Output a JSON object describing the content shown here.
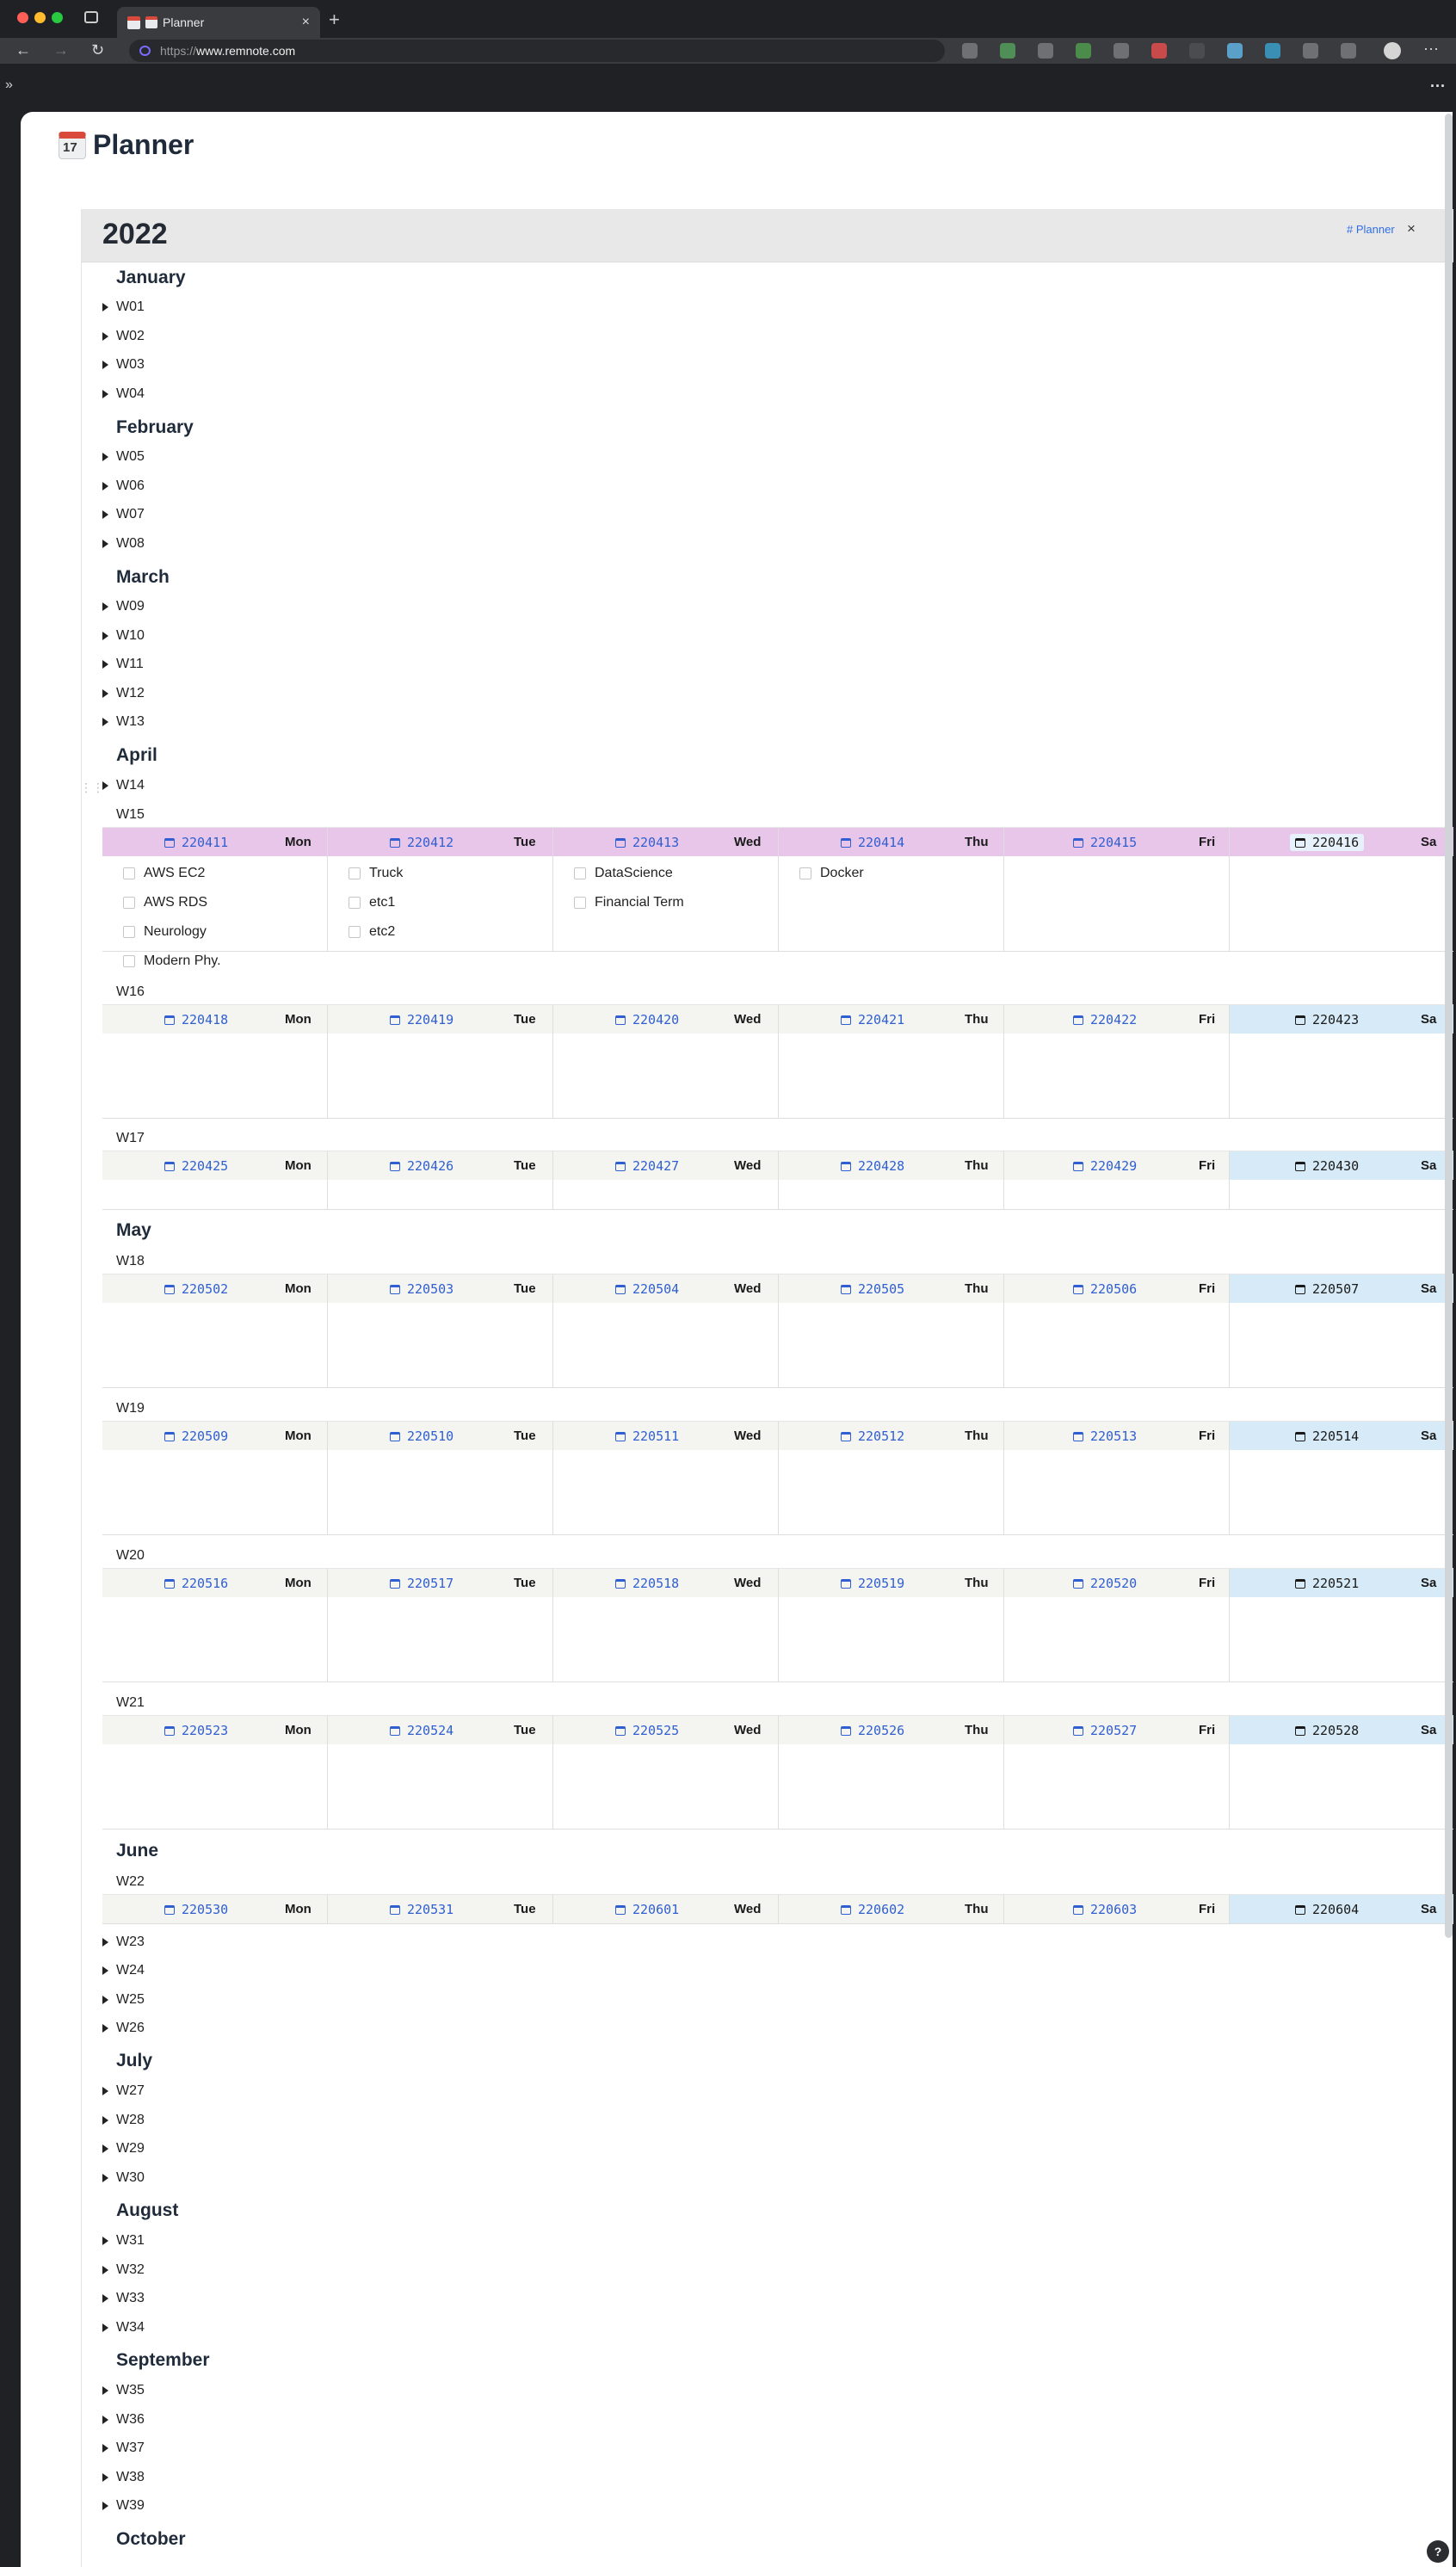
{
  "browser": {
    "tab_title": "Planner",
    "url_prefix": "https://",
    "url_host": "www.remnote.com",
    "new_tab": "+",
    "tab_close": "×",
    "more": "···"
  },
  "page": {
    "title": "Planner",
    "expand_sidebar": "»",
    "more_options": "···",
    "help": "?"
  },
  "year": {
    "title": "2022",
    "tag": "# Planner",
    "tag_close": "×"
  },
  "months": {
    "jan": "January",
    "feb": "February",
    "mar": "March",
    "apr": "April",
    "may": "May",
    "jun": "June",
    "jul": "July",
    "aug": "August",
    "sep": "September",
    "oct": "October"
  },
  "weeks": {
    "w01": "W01",
    "w02": "W02",
    "w03": "W03",
    "w04": "W04",
    "w05": "W05",
    "w06": "W06",
    "w07": "W07",
    "w08": "W08",
    "w09": "W09",
    "w10": "W10",
    "w11": "W11",
    "w12": "W12",
    "w13": "W13",
    "w14": "W14",
    "w15": "W15",
    "w16": "W16",
    "w17": "W17",
    "w18": "W18",
    "w19": "W19",
    "w20": "W20",
    "w21": "W21",
    "w22": "W22",
    "w23": "W23",
    "w24": "W24",
    "w25": "W25",
    "w26": "W26",
    "w27": "W27",
    "w28": "W28",
    "w29": "W29",
    "w30": "W30",
    "w31": "W31",
    "w32": "W32",
    "w33": "W33",
    "w34": "W34",
    "w35": "W35",
    "w36": "W36",
    "w37": "W37",
    "w38": "W38",
    "w39": "W39"
  },
  "day_names": [
    "Mon",
    "Tue",
    "Wed",
    "Thu",
    "Fri",
    "Sa"
  ],
  "grids": {
    "w15": [
      "220411",
      "220412",
      "220413",
      "220414",
      "220415",
      "220416"
    ],
    "w16": [
      "220418",
      "220419",
      "220420",
      "220421",
      "220422",
      "220423"
    ],
    "w17": [
      "220425",
      "220426",
      "220427",
      "220428",
      "220429",
      "220430"
    ],
    "w18": [
      "220502",
      "220503",
      "220504",
      "220505",
      "220506",
      "220507"
    ],
    "w19": [
      "220509",
      "220510",
      "220511",
      "220512",
      "220513",
      "220514"
    ],
    "w20": [
      "220516",
      "220517",
      "220518",
      "220519",
      "220520",
      "220521"
    ],
    "w21": [
      "220523",
      "220524",
      "220525",
      "220526",
      "220527",
      "220528"
    ],
    "w22": [
      "220530",
      "220531",
      "220601",
      "220602",
      "220603",
      "220604"
    ]
  },
  "todos": {
    "mon": [
      "AWS EC2",
      "AWS RDS",
      "Neurology",
      "Modern Phy."
    ],
    "tue": [
      "Truck",
      "etc1",
      "etc2"
    ],
    "wed": [
      "DataScience",
      "Financial Term"
    ],
    "thu": [
      "Docker"
    ]
  },
  "colors": {
    "link": "#2f5fd2",
    "today_header": "#e8c6ea",
    "saturday_header": "#d6eaf7",
    "weekday_header": "#f4f4f0"
  }
}
